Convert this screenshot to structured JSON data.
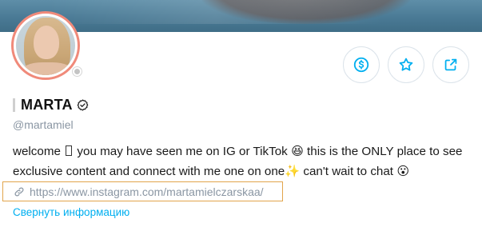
{
  "profile": {
    "display_name": "MARTA",
    "handle": "@martamiel",
    "bio": {
      "part1": "welcome",
      "part2": "you may have seen me on IG or TikTok 😆 this is the ONLY place to see exclusive content and connect with me one on one✨ can't wait to chat 😮"
    },
    "link": "https://www.instagram.com/martamielczarskaa/",
    "collapse_label": "Свернуть информацию"
  },
  "actions": [
    {
      "icon": "dollar-circle-icon"
    },
    {
      "icon": "star-icon"
    },
    {
      "icon": "share-icon"
    }
  ],
  "colors": {
    "accent": "#00aff0",
    "avatar_ring": "#f08a7a",
    "link_box_border": "#e2a54c",
    "muted_text": "#8a96a3"
  }
}
